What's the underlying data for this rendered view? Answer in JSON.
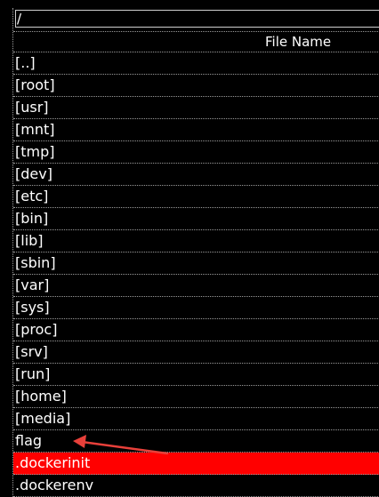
{
  "path": "/",
  "header": {
    "file_name": "File Name"
  },
  "files": [
    {
      "name": "[..]",
      "selected": false
    },
    {
      "name": "[root]",
      "selected": false
    },
    {
      "name": "[usr]",
      "selected": false
    },
    {
      "name": "[mnt]",
      "selected": false
    },
    {
      "name": "[tmp]",
      "selected": false
    },
    {
      "name": "[dev]",
      "selected": false
    },
    {
      "name": "[etc]",
      "selected": false
    },
    {
      "name": "[bin]",
      "selected": false
    },
    {
      "name": "[lib]",
      "selected": false
    },
    {
      "name": "[sbin]",
      "selected": false
    },
    {
      "name": "[var]",
      "selected": false
    },
    {
      "name": "[sys]",
      "selected": false
    },
    {
      "name": "[proc]",
      "selected": false
    },
    {
      "name": "[srv]",
      "selected": false
    },
    {
      "name": "[run]",
      "selected": false
    },
    {
      "name": "[home]",
      "selected": false
    },
    {
      "name": "[media]",
      "selected": false
    },
    {
      "name": "flag",
      "selected": false
    },
    {
      "name": ".dockerinit",
      "selected": true
    },
    {
      "name": ".dockerenv",
      "selected": false
    }
  ],
  "colors": {
    "background": "#000000",
    "text": "#ffffff",
    "selection": "#ff0000",
    "annotation_arrow": "#e8403a",
    "grid_line": "#9a9a9a"
  },
  "annotation": {
    "type": "arrow",
    "points_to": "flag"
  }
}
